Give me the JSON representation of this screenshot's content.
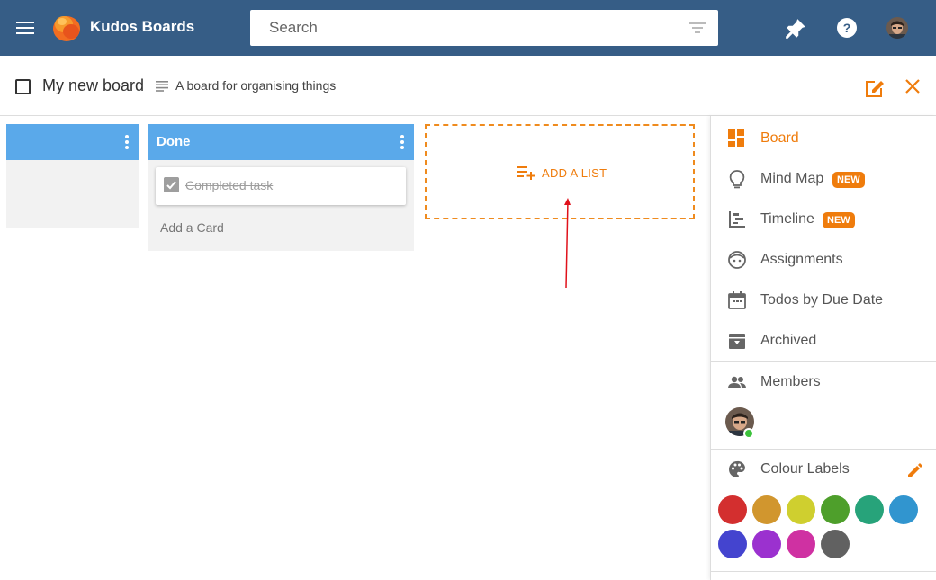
{
  "app": {
    "title": "Kudos Boards"
  },
  "search": {
    "placeholder": "Search"
  },
  "board": {
    "title": "My new board",
    "description": "A board for organising things"
  },
  "lists": [
    {
      "title": ""
    },
    {
      "title": "Done",
      "cards": [
        {
          "text": "Completed task",
          "completed": true
        }
      ],
      "add_card_label": "Add a Card"
    }
  ],
  "add_list": {
    "label": "ADD A LIST"
  },
  "sidebar": {
    "items": [
      {
        "label": "Board",
        "icon": "dashboard-icon",
        "active": true
      },
      {
        "label": "Mind Map",
        "icon": "lightbulb-icon",
        "badge": "NEW"
      },
      {
        "label": "Timeline",
        "icon": "timeline-icon",
        "badge": "NEW"
      },
      {
        "label": "Assignments",
        "icon": "face-icon"
      },
      {
        "label": "Todos by Due Date",
        "icon": "calendar-icon"
      },
      {
        "label": "Archived",
        "icon": "archive-icon"
      }
    ],
    "members_label": "Members",
    "colour_labels_title": "Colour Labels",
    "colour_swatches": [
      "#d32f2f",
      "#d1962e",
      "#cfcf2f",
      "#4e9f2b",
      "#27a37a",
      "#3195cf",
      "#4444cf",
      "#9b31cf",
      "#cf31a2",
      "#616161"
    ]
  },
  "colors": {
    "header": "#365d86",
    "accent": "#ef7c0c",
    "list_header": "#5aa9ea"
  }
}
